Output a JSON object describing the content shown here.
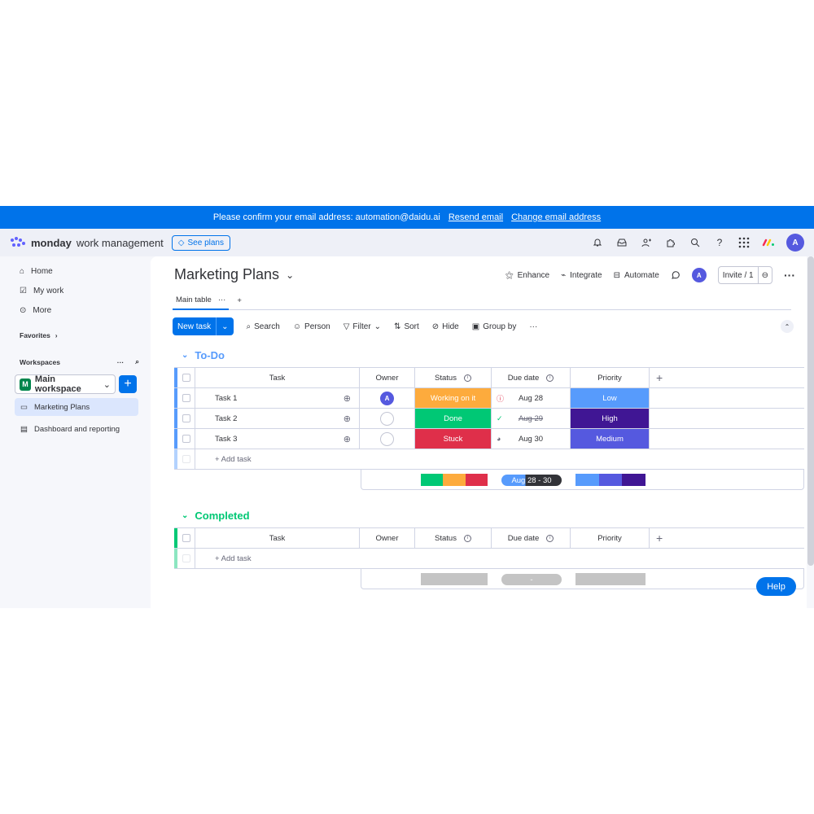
{
  "banner": {
    "text": "Please confirm your email address: automation@daidu.ai",
    "resend": "Resend email",
    "change": "Change email address"
  },
  "topbar": {
    "brand_bold": "monday",
    "brand_light": "work management",
    "see_plans": "See plans",
    "avatar": "A"
  },
  "sidebar": {
    "home": "Home",
    "my_work": "My work",
    "more": "More",
    "favorites": "Favorites",
    "workspaces": "Workspaces",
    "workspace_badge": "M",
    "workspace_name": "Main workspace",
    "boards": [
      "Marketing Plans",
      "Dashboard and reporting"
    ]
  },
  "board": {
    "title": "Marketing Plans",
    "actions": {
      "enhance": "Enhance",
      "integrate": "Integrate",
      "automate": "Automate",
      "avatar": "A",
      "invite": "Invite / 1"
    },
    "view": "Main table",
    "toolbar": {
      "new_task": "New task",
      "search": "Search",
      "person": "Person",
      "filter": "Filter",
      "sort": "Sort",
      "hide": "Hide",
      "group_by": "Group by"
    }
  },
  "columns": {
    "task": "Task",
    "owner": "Owner",
    "status": "Status",
    "due": "Due date",
    "priority": "Priority"
  },
  "groups": [
    {
      "title": "To-Do",
      "color": "#579bfc",
      "rows": [
        {
          "task": "Task 1",
          "owner": "A",
          "status": "Working on it",
          "status_color": "#fdab3d",
          "due": "Aug 28",
          "priority": "Low",
          "priority_color": "#579bfc"
        },
        {
          "task": "Task 2",
          "owner": "",
          "status": "Done",
          "status_color": "#00c875",
          "due": "Aug 29",
          "priority": "High",
          "priority_color": "#401694"
        },
        {
          "task": "Task 3",
          "owner": "",
          "status": "Stuck",
          "status_color": "#df2f4a",
          "due": "Aug 30",
          "priority": "Medium",
          "priority_color": "#5559df"
        }
      ],
      "add_task": "+ Add task",
      "summary_date": "Aug 28 - 30"
    },
    {
      "title": "Completed",
      "color": "#00c875",
      "rows": [],
      "add_task": "+ Add task",
      "summary_date": "-"
    }
  ],
  "help": "Help"
}
